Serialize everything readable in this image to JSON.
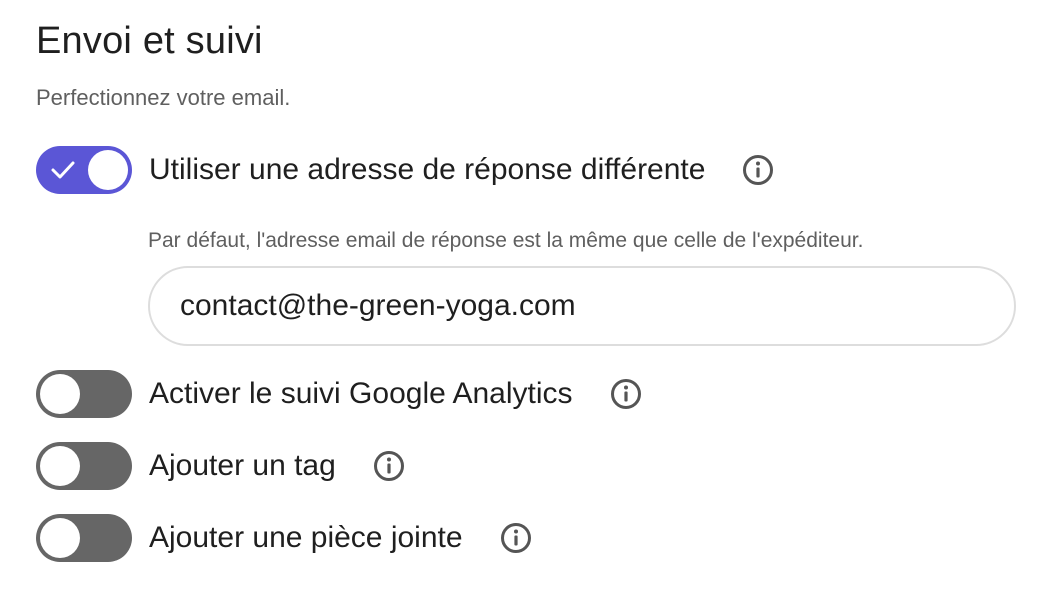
{
  "section": {
    "title": "Envoi et suivi",
    "subtitle": "Perfectionnez votre email."
  },
  "reply_to": {
    "label": "Utiliser une adresse de réponse différente",
    "enabled": true,
    "info_icon": "info-icon",
    "help_text": "Par défaut, l'adresse email de réponse est la même que celle de l'expéditeur.",
    "email_value": "contact@the-green-yoga.com"
  },
  "google_analytics": {
    "label": "Activer le suivi Google Analytics",
    "enabled": false,
    "info_icon": "info-icon"
  },
  "tag": {
    "label": "Ajouter un tag",
    "enabled": false,
    "info_icon": "info-icon"
  },
  "attachment": {
    "label": "Ajouter une pièce jointe",
    "enabled": false,
    "info_icon": "info-icon"
  },
  "colors": {
    "toggle_on": "#5b56d6",
    "toggle_off": "#666666",
    "icon": "#555555"
  }
}
